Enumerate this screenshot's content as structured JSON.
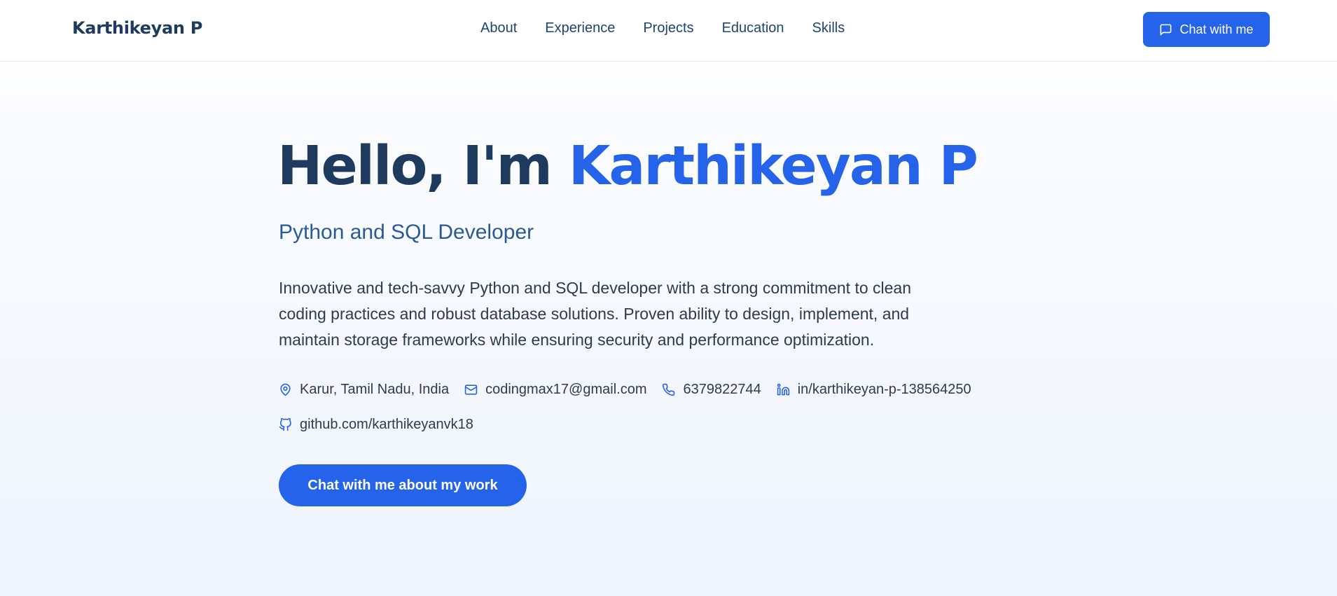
{
  "header": {
    "brand": "Karthikeyan P",
    "nav": [
      "About",
      "Experience",
      "Projects",
      "Education",
      "Skills"
    ],
    "cta_label": "Chat with me"
  },
  "hero": {
    "greeting": "Hello, I'm ",
    "name": "Karthikeyan P",
    "subtitle": "Python and SQL Developer",
    "description_lines": [
      "Innovative and tech-savvy Python and SQL developer with a strong commitment to clean",
      "coding practices and robust database solutions. Proven ability to design, implement, and",
      "maintain storage frameworks while ensuring security and performance optimization."
    ],
    "contacts": {
      "location": "Karur, Tamil Nadu, India",
      "email": "codingmax17@gmail.com",
      "phone": "6379822744",
      "linkedin": "in/karthikeyan-p-138564250",
      "github": "github.com/karthikeyanvk18"
    },
    "cta_label": "Chat with me about my work"
  },
  "icons": {
    "header_cta": "chat-bubble-icon",
    "location": "map-pin-icon",
    "email": "mail-icon",
    "phone": "phone-icon",
    "linkedin": "linkedin-icon",
    "github": "github-icon"
  },
  "colors": {
    "accent": "#2563eb",
    "heading": "#1e3a5f",
    "subtitle": "#2a5a97",
    "body_text": "#2f3b4d"
  }
}
